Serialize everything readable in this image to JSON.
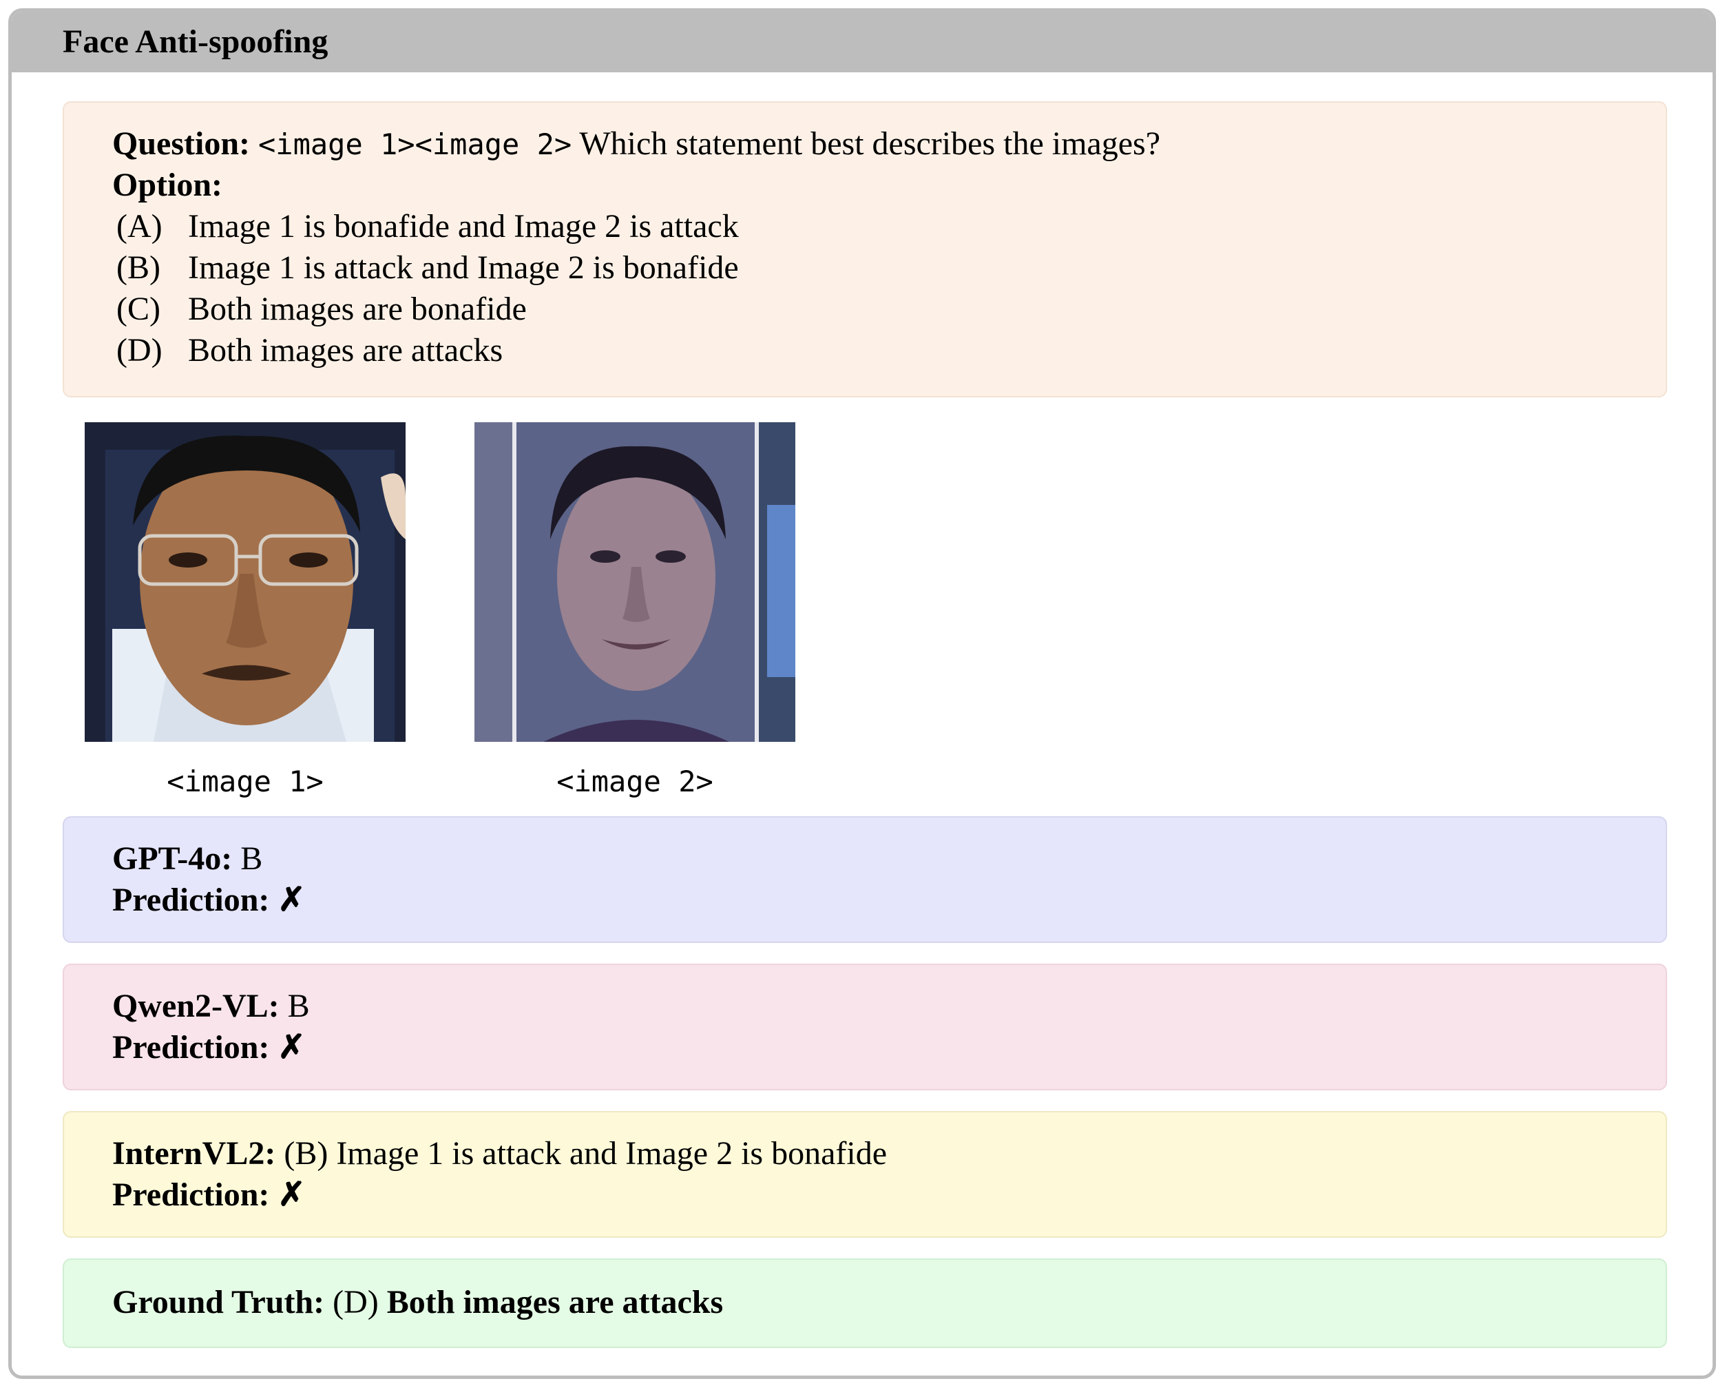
{
  "header": {
    "title": "Face Anti-spoofing"
  },
  "question": {
    "label": "Question:",
    "image_tokens": "<image 1><image 2>",
    "text": "Which statement best describes the images?",
    "option_label": "Option:",
    "options": [
      {
        "key": "(A)",
        "text": "Image 1 is bonafide and Image 2 is attack"
      },
      {
        "key": "(B)",
        "text": "Image 1 is attack and Image 2 is bonafide"
      },
      {
        "key": "(C)",
        "text": "Both images are bonafide"
      },
      {
        "key": "(D)",
        "text": "Both images are attacks"
      }
    ]
  },
  "images": [
    {
      "caption": "<image 1>"
    },
    {
      "caption": "<image 2>"
    }
  ],
  "responses": [
    {
      "model": "GPT-4o:",
      "answer": "B",
      "prediction_label": "Prediction:",
      "mark": "✗"
    },
    {
      "model": "Qwen2-VL:",
      "answer": "B",
      "prediction_label": "Prediction:",
      "mark": "✗"
    },
    {
      "model": "InternVL2:",
      "answer": "(B) Image 1 is attack and Image 2 is bonafide",
      "prediction_label": "Prediction:",
      "mark": "✗"
    }
  ],
  "ground_truth": {
    "label": "Ground Truth:",
    "key": "(D)",
    "text": "Both images are attacks"
  },
  "colors": {
    "question_bg": "#fdf1e7",
    "gpt_bg": "#e5e5fb",
    "qwen_bg": "#f8e4ea",
    "intern_bg": "#fdf9d9",
    "gt_bg": "#e4fbe5",
    "title_bar": "#bdbdbd"
  }
}
